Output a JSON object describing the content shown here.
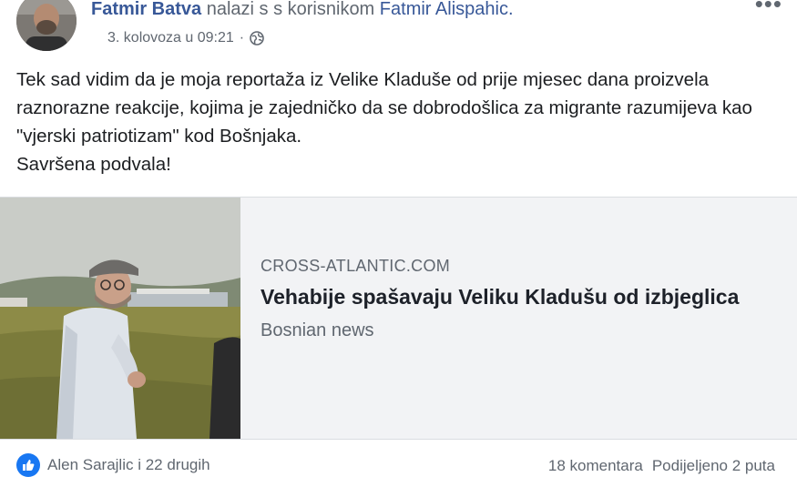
{
  "header": {
    "author_name": "Fatmir Batva",
    "with_text": "nalazi s s korisnikom",
    "tagged_name": "Fatmir Alispahic.",
    "date": "3. kolovoza u 09:21",
    "separator": "·",
    "more_label": "•••"
  },
  "post": {
    "lines": [
      "Tek sad vidim da je moja reportaža iz Velike Kladuše od prije mjesec dana proizvela raznorazne reakcije, kojima je zajedničko da se dobrodošlica za migrante razumijeva kao \"vjerski patriotizam\" kod Bošnjaka.",
      "Savršena podvala!"
    ]
  },
  "link_preview": {
    "domain": "CROSS-ATLANTIC.COM",
    "title": "Vehabije spašavaju Veliku Kladušu od izbjeglica",
    "description": "Bosnian news"
  },
  "footer": {
    "reactions_text": "Alen Sarajlic i 22 drugih",
    "comments": "18 komentara",
    "shares": "Podijeljeno 2 puta"
  },
  "icons": {
    "globe": "globe-icon",
    "like": "like-icon",
    "more": "more-icon"
  },
  "colors": {
    "link_blue": "#385898",
    "like_blue": "#1877f2",
    "secondary_text": "#606770",
    "card_background": "#f2f3f5"
  }
}
